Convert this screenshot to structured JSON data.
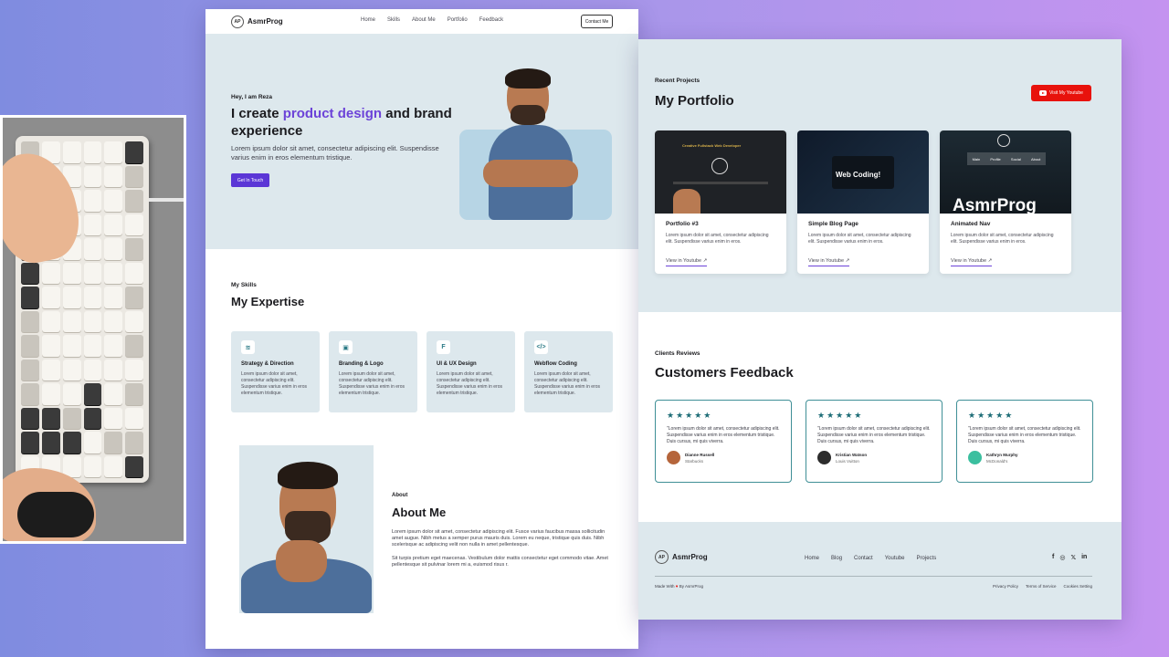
{
  "left_page": {
    "brand": "AsmrProg",
    "logo_text": "AP",
    "nav": [
      "Home",
      "Skills",
      "About Me",
      "Portfolio",
      "Feedback"
    ],
    "contact_button": "Contact Me",
    "hero": {
      "greeting": "Hey, I am Reza",
      "headline_pre": "I create ",
      "headline_highlight": "product design",
      "headline_post": " and brand experience",
      "description": "Lorem ipsum dolor sit amet, consectetur adipiscing elit. Suspendisse varius enim in eros elementum tristique.",
      "cta": "Get In Touch"
    },
    "skills": {
      "subtitle": "My Skills",
      "title": "My Expertise",
      "cards": [
        {
          "name": "Strategy & Direction",
          "desc": "Lorem ipsum dolor sit amet, consectetur adipiscing elit. Suspendisse varius enim in eros elementum tristique.",
          "icon": "layers-icon",
          "glyph": "≋"
        },
        {
          "name": "Branding & Logo",
          "desc": "Lorem ipsum dolor sit amet, consectetur adipiscing elit. Suspendisse varius enim in eros elementum tristique.",
          "icon": "badge-icon",
          "glyph": "▣"
        },
        {
          "name": "UI & UX Design",
          "desc": "Lorem ipsum dolor sit amet, consectetur adipiscing elit. Suspendisse varius enim in eros elementum tristique.",
          "icon": "figma-icon",
          "glyph": "F"
        },
        {
          "name": "Webflow Coding",
          "desc": "Lorem ipsum dolor sit amet, consectetur adipiscing elit. Suspendisse varius enim in eros elementum tristique.",
          "icon": "code-icon",
          "glyph": "</>"
        }
      ]
    },
    "about": {
      "subtitle": "About",
      "title": "About Me",
      "p1": "Lorem ipsum dolor sit amet, consectetur adipiscing elit. Fusce varius faucibus massa sollicitudin amet augue. Nibh metus a semper purus mauris duis. Lorem eu neque, tristique quis duis. Nibh scelerisque ac adipiscing velit non nulla in amet pellentesque.",
      "p2": "Sit turpis pretium eget maecenas. Vestibulum dolor mattis consectetur eget commodo vitae. Amet pellentesque sit pulvinar lorem mi a, euismod risus r."
    }
  },
  "right_page": {
    "portfolio": {
      "subtitle": "Recent Projects",
      "title": "My Portfolio",
      "youtube_button": "Visit My Youtube",
      "projects": [
        {
          "name": "Portfolio #3",
          "desc": "Lorem ipsum dolor sit amet, consectetur adipiscing elit. Suspendisse varius enim in eros.",
          "link": "View in Youtube",
          "thumb_text": "Creative Fullstack Web Developer"
        },
        {
          "name": "Simple Blog Page",
          "desc": "Lorem ipsum dolor sit amet, consectetur adipiscing elit. Suspendisse varius enim in eros.",
          "link": "View in Youtube",
          "thumb_text": "Web Coding!"
        },
        {
          "name": "Animated Nav",
          "desc": "Lorem ipsum dolor sit amet, consectetur adipiscing elit. Suspendisse varius enim in eros.",
          "link": "View in Youtube",
          "thumb_text": "AsmrProg",
          "thumb_nav": [
            "Main",
            "Profile",
            "Social",
            "About"
          ]
        }
      ]
    },
    "reviews": {
      "subtitle": "Clients Reviews",
      "title": "Customers Feedback",
      "stars": "★★★★★",
      "items": [
        {
          "quote": "\"Lorem ipsum dolor sit amet, consectetur adipiscing elit. Suspendisse varius enim in eros elementum tristique. Duis cursus, mi quis viverra.",
          "name": "Dianne Russell",
          "company": "Starbucks",
          "avatar_color": "#b5653b"
        },
        {
          "quote": "\"Lorem ipsum dolor sit amet, consectetur adipiscing elit. Suspendisse varius enim in eros elementum tristique. Duis cursus, mi quis viverra.",
          "name": "Kristian Watson",
          "company": "Louis Vuitton",
          "avatar_color": "#2c2c2c"
        },
        {
          "quote": "\"Lorem ipsum dolor sit amet, consectetur adipiscing elit. Suspendisse varius enim in eros elementum tristique. Duis cursus, mi quis viverra.",
          "name": "Kathryn Murphy",
          "company": "McDonald's",
          "avatar_color": "#3bbf9f"
        }
      ]
    },
    "footer": {
      "brand": "AsmrProg",
      "links": [
        "Home",
        "Blog",
        "Contact",
        "Youtube",
        "Projects"
      ],
      "social": [
        "f",
        "◎",
        "𝕏",
        "in"
      ],
      "made_pre": "Made With",
      "made_post": "By AsmrProg",
      "legal": [
        "Privacy Policy",
        "Terms of Service",
        "Cookies Setting"
      ]
    }
  },
  "colors": {
    "accent": "#6c43d8",
    "primary_button": "#5b36d6",
    "youtube": "#e8120c",
    "review_border": "#3f8f96",
    "section_bg": "#dde8ed"
  }
}
